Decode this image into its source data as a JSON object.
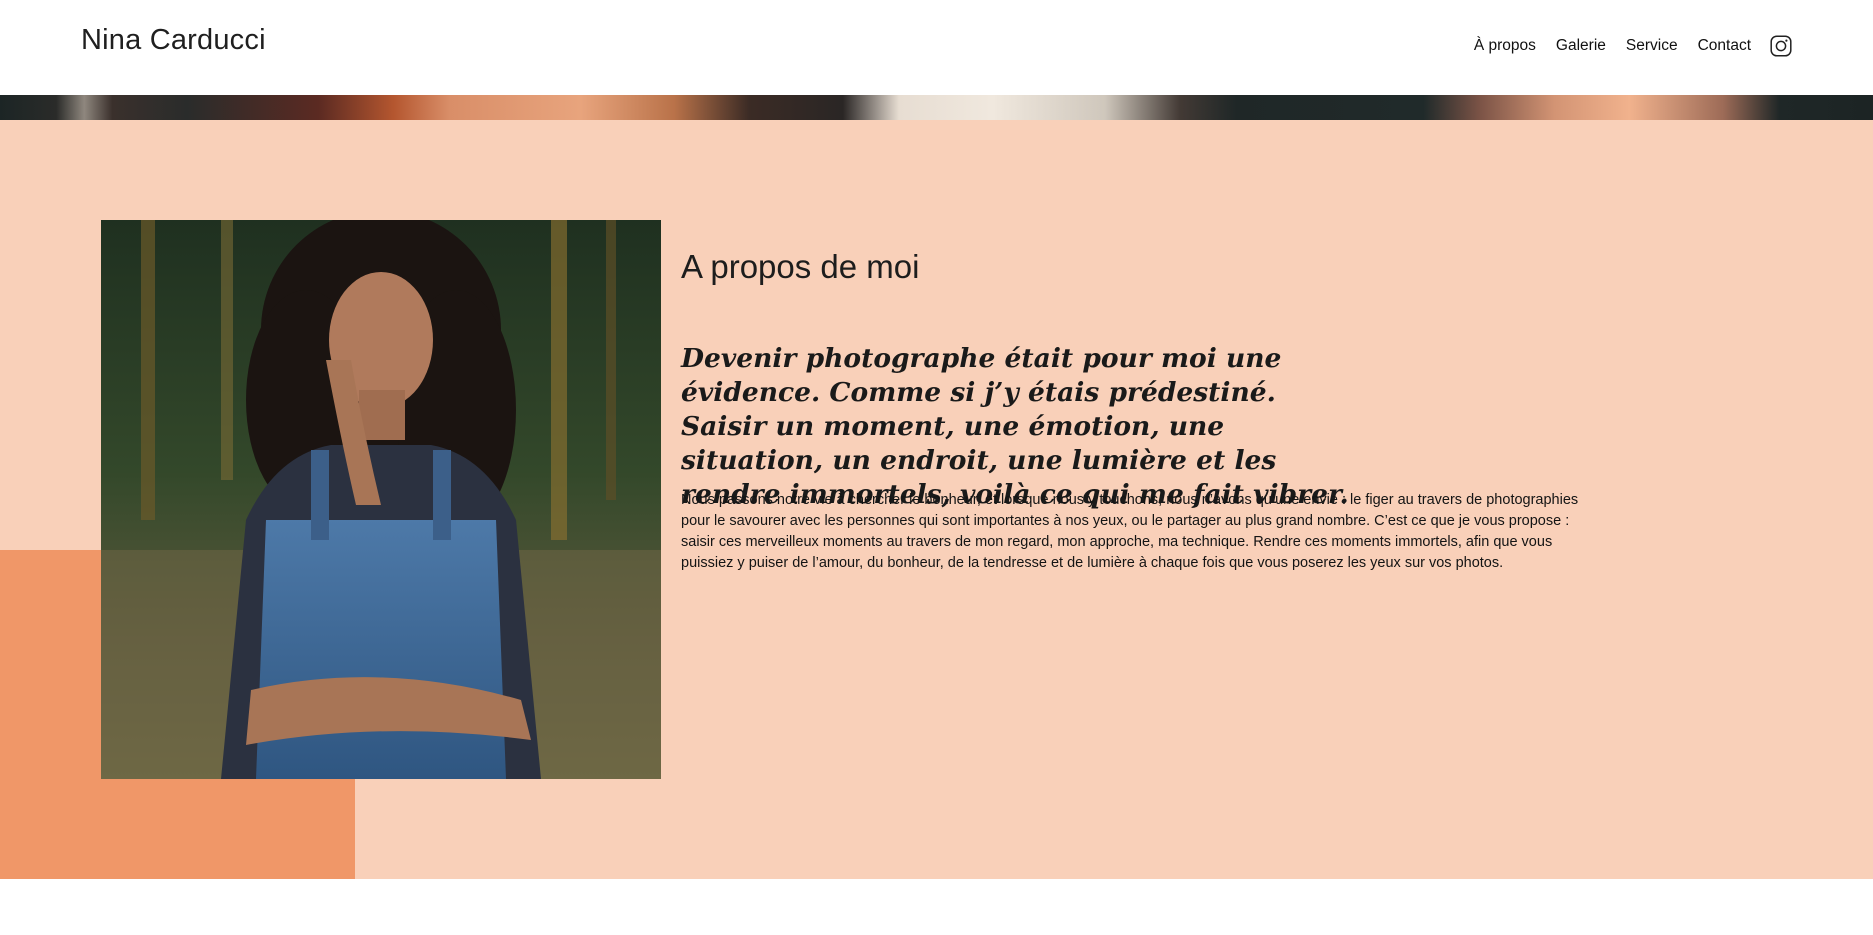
{
  "header": {
    "logo": "Nina Carducci",
    "nav": {
      "about": "À propos",
      "gallery": "Galerie",
      "service": "Service",
      "contact": "Contact"
    },
    "instagram_icon": "instagram-icon"
  },
  "about": {
    "title": "A propos de moi",
    "quote": "Devenir photographe était pour moi une évidence. Comme si j’y étais prédestiné. Saisir un moment, une émotion, une situation, un endroit, une lumière et les rendre immortels, voilà ce qui me fait vibrer.",
    "text": "Nous passons notre vie à chercher le bonheur, et lorsque nous y touchons, nous n’avons qu’une envie : le figer au travers de photographies pour le savourer avec les personnes qui sont importantes à nos yeux, ou le partager au plus grand nombre. C’est ce que je vous propose : saisir ces merveilleux moments au travers de mon regard, mon approche, ma technique. Rendre ces moments immortels, afin que vous puissiez y puiser de l’amour, du bonheur, de la tendresse et de lumière à chaque fois que vous poserez les yeux sur vos photos."
  },
  "colors": {
    "section_bg": "#f9d0b9",
    "accent": "#f09768",
    "text": "#1d1d1d"
  }
}
